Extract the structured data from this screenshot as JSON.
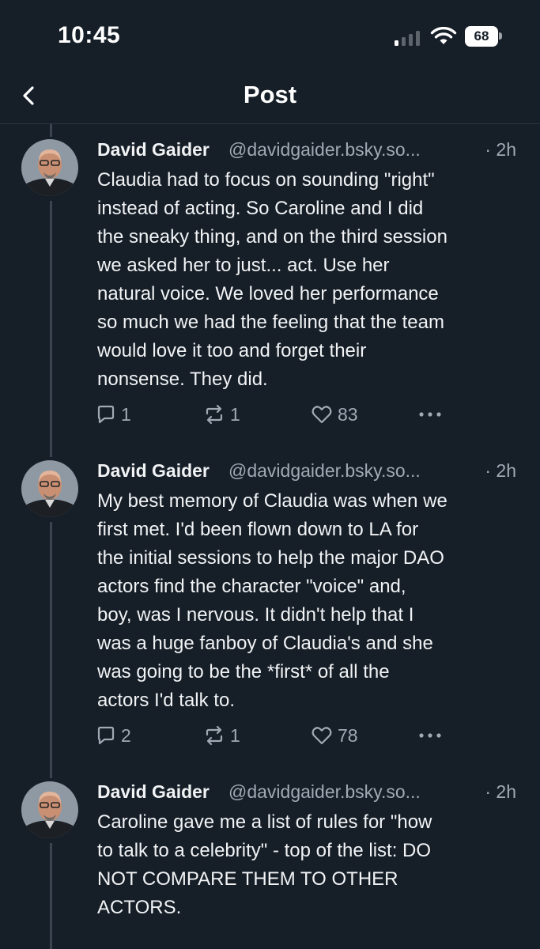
{
  "status_bar": {
    "time": "10:45",
    "battery_level": "68",
    "icons": [
      "signal-icon",
      "wifi-icon",
      "battery-icon"
    ]
  },
  "header": {
    "title": "Post",
    "back_icon": "chevron-left-icon"
  },
  "colors": {
    "background": "#161e27",
    "text": "#f1f3f5",
    "secondary_text": "#a0aab5",
    "thread_line": "#3a4552"
  },
  "posts": [
    {
      "author": "David Gaider",
      "handle": "@davidgaider.bsky.so...",
      "time": "· 2h",
      "lines": [
        "Claudia had to focus on sounding \"right\"",
        "instead of acting. So Caroline and I did",
        "the sneaky thing, and on the third session",
        "we asked her to just... act. Use her",
        "natural voice. We loved her performance",
        "so much we had the feeling that the team",
        "would love it too and forget their",
        "nonsense. They did."
      ],
      "replies": "1",
      "reposts": "1",
      "likes": "83"
    },
    {
      "author": "David Gaider",
      "handle": "@davidgaider.bsky.so...",
      "time": "· 2h",
      "lines": [
        "My best memory of Claudia was when we",
        "first met. I'd been flown down to LA for",
        "the initial sessions to help the major DAO",
        "actors find the character \"voice\" and,",
        "boy, was I nervous. It didn't help that I",
        "was a huge fanboy of Claudia's and she",
        "was going to be the *first* of all the",
        "actors I'd talk to."
      ],
      "replies": "2",
      "reposts": "1",
      "likes": "78"
    },
    {
      "author": "David Gaider",
      "handle": "@davidgaider.bsky.so...",
      "time": "· 2h",
      "lines": [
        "Caroline gave me a list of rules for \"how",
        "to talk to a celebrity\" - top of the list: DO",
        "NOT COMPARE THEM TO OTHER",
        "ACTORS."
      ]
    }
  ]
}
